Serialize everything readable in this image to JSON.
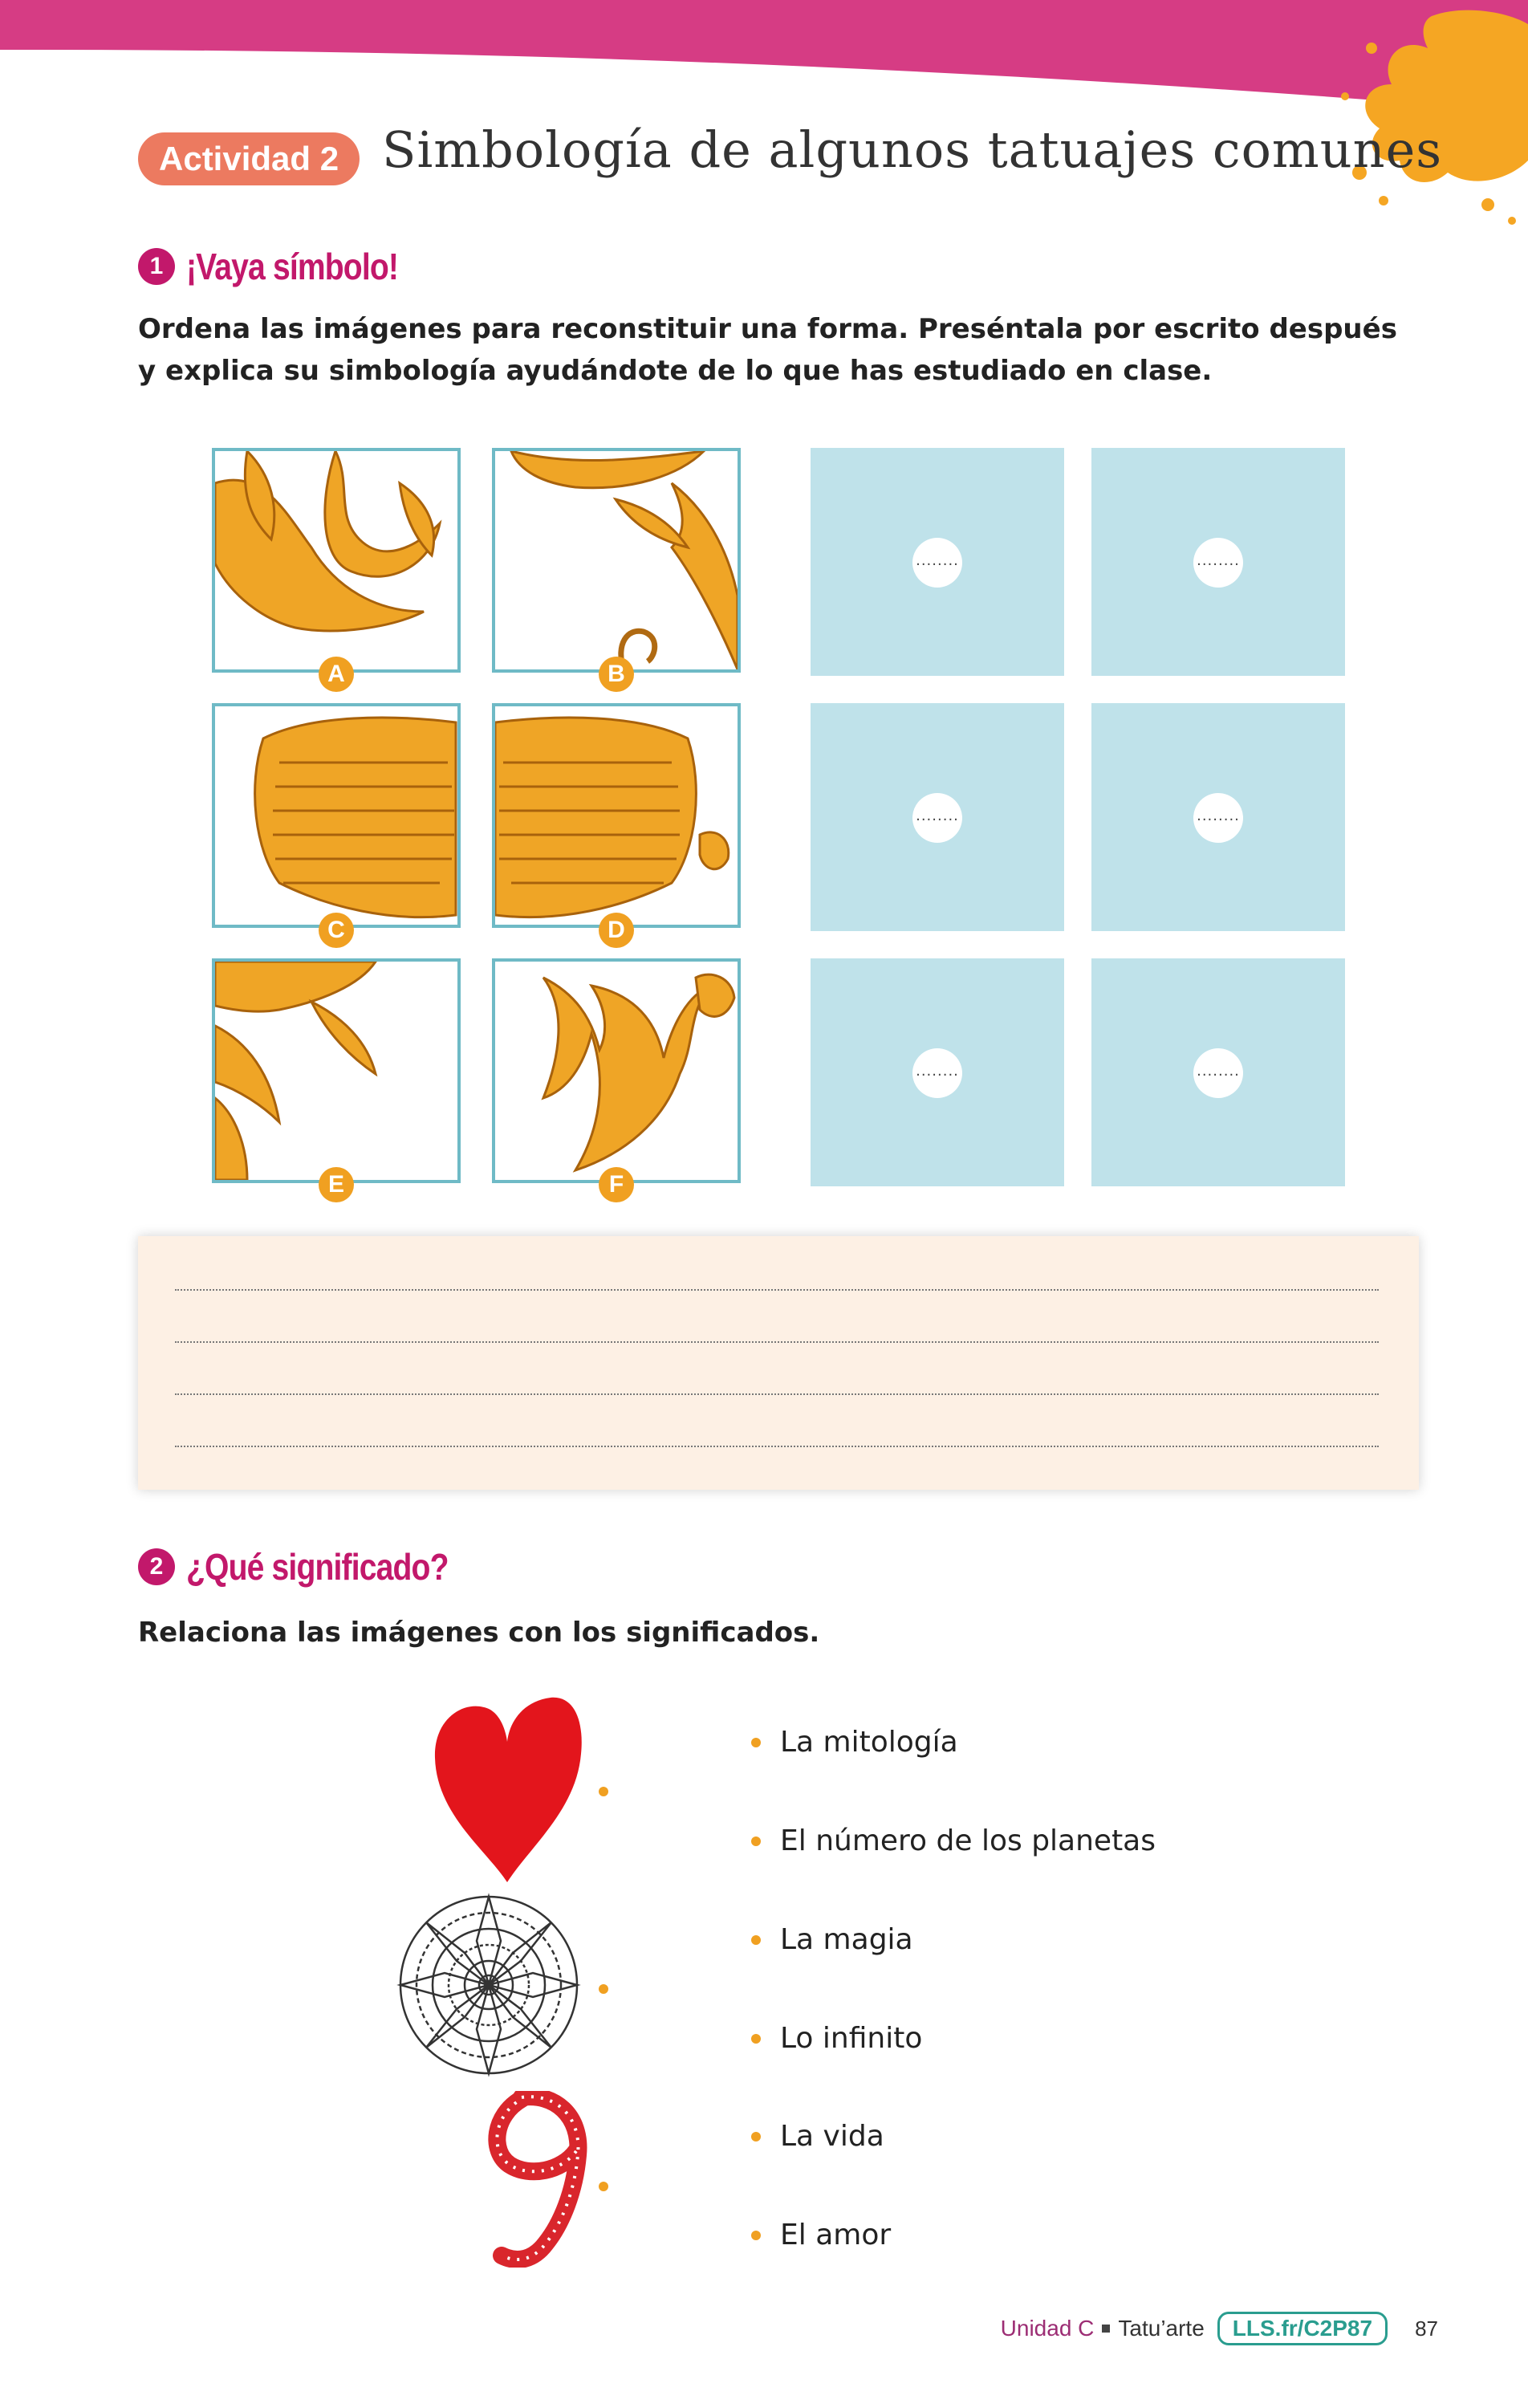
{
  "header": {
    "activity_label": "Actividad 2",
    "title": "Simbología de algunos tatuajes comunes",
    "band_color": "#d63c84",
    "splash_color": "#f5a623"
  },
  "section1": {
    "number": "1",
    "title": "¡Vaya símbolo!",
    "instructions": "Ordena las imágenes para reconstituir una forma. Preséntala por escrito después y explica su simbología ayudándote de lo que has estudiado en clase.",
    "tiles": [
      {
        "letter": "A",
        "icon": "phoenix-tail-feathers"
      },
      {
        "letter": "B",
        "icon": "phoenix-wing-tip"
      },
      {
        "letter": "C",
        "icon": "phoenix-left-wing"
      },
      {
        "letter": "D",
        "icon": "phoenix-right-wing"
      },
      {
        "letter": "E",
        "icon": "phoenix-feather-edge"
      },
      {
        "letter": "F",
        "icon": "phoenix-head-flames"
      }
    ],
    "answer_placeholder": "........",
    "answer_color": "#bfe2ea",
    "writing_lines": 4
  },
  "section2": {
    "number": "2",
    "title": "¿Qué significado?",
    "instructions": "Relaciona las imágenes con los significados.",
    "images": [
      {
        "name": "heart",
        "color": "#e3151c"
      },
      {
        "name": "mandala",
        "color": "#333333"
      },
      {
        "name": "number-nine",
        "color": "#d9262c"
      }
    ],
    "meanings": [
      "La mitología",
      "El número de los planetas",
      "La magia",
      "Lo infinito",
      "La vida",
      "El amor"
    ]
  },
  "footer": {
    "unit": "Unidad C",
    "subtitle": "Tatu’arte",
    "link": "LLS.fr/C2P87",
    "page": "87"
  }
}
